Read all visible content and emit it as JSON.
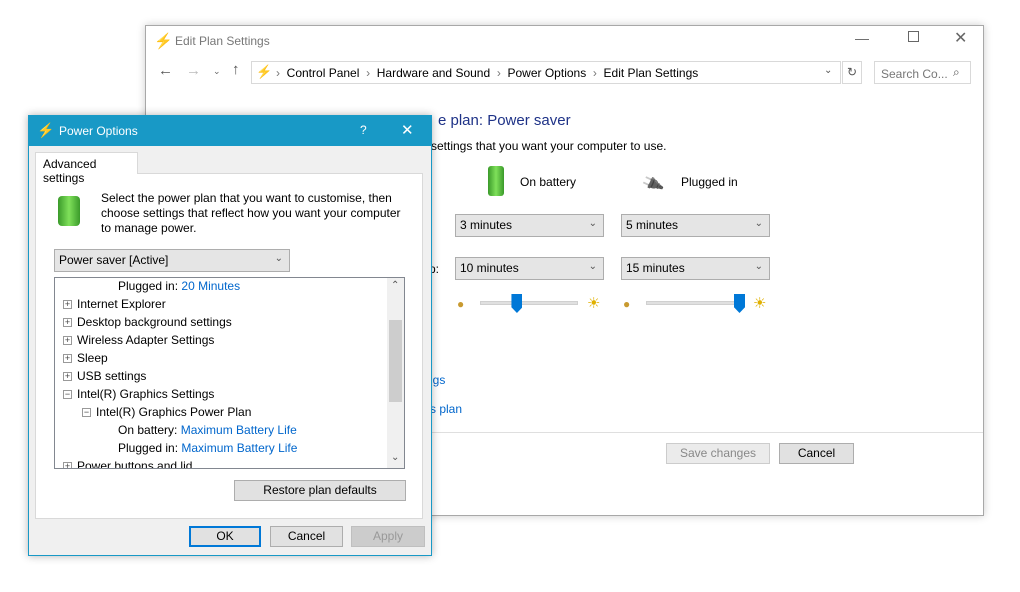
{
  "back_window": {
    "title": "Edit Plan Settings",
    "breadcrumb": [
      "Control Panel",
      "Hardware and Sound",
      "Power Options",
      "Edit Plan Settings"
    ],
    "search_placeholder": "Search Co...",
    "heading_fragment": "e plan: Power saver",
    "subheading_fragment": "settings that you want your computer to use.",
    "col_battery": "On battery",
    "col_plugged": "Plugged in",
    "row2_label_fragment": "p:",
    "display_battery": "3 minutes",
    "display_plugged": "5 minutes",
    "sleep_battery": "10 minutes",
    "sleep_plugged": "15 minutes",
    "brightness_battery_percent": 35,
    "brightness_plugged_percent": 100,
    "link1_fragment": "ngs",
    "link2_fragment": "s plan",
    "save_label": "Save changes",
    "cancel_label": "Cancel",
    "accent": "#0066cc"
  },
  "dialog": {
    "title": "Power Options",
    "help": "?",
    "close": "✕",
    "tab": "Advanced settings",
    "description": "Select the power plan that you want to customise, then choose settings that reflect how you want your computer to manage power.",
    "plan": "Power saver [Active]",
    "tree": [
      {
        "label": "Plugged in:",
        "value": "20 Minutes",
        "level": 2
      },
      {
        "label": "Internet Explorer",
        "expander": "+",
        "level": 0
      },
      {
        "label": "Desktop background settings",
        "expander": "+",
        "level": 0
      },
      {
        "label": "Wireless Adapter Settings",
        "expander": "+",
        "level": 0
      },
      {
        "label": "Sleep",
        "expander": "+",
        "level": 0
      },
      {
        "label": "USB settings",
        "expander": "+",
        "level": 0
      },
      {
        "label": "Intel(R) Graphics Settings",
        "expander": "−",
        "level": 0
      },
      {
        "label": "Intel(R) Graphics Power Plan",
        "expander": "−",
        "level": 1
      },
      {
        "label": "On battery:",
        "value": "Maximum Battery Life",
        "level": 2
      },
      {
        "label": "Plugged in:",
        "value": "Maximum Battery Life",
        "level": 2
      },
      {
        "label": "Power buttons and lid",
        "expander": "+",
        "level": 0
      }
    ],
    "restore_label": "Restore plan defaults",
    "ok_label": "OK",
    "cancel_label": "Cancel",
    "apply_label": "Apply",
    "title_color": "#1899c6"
  }
}
